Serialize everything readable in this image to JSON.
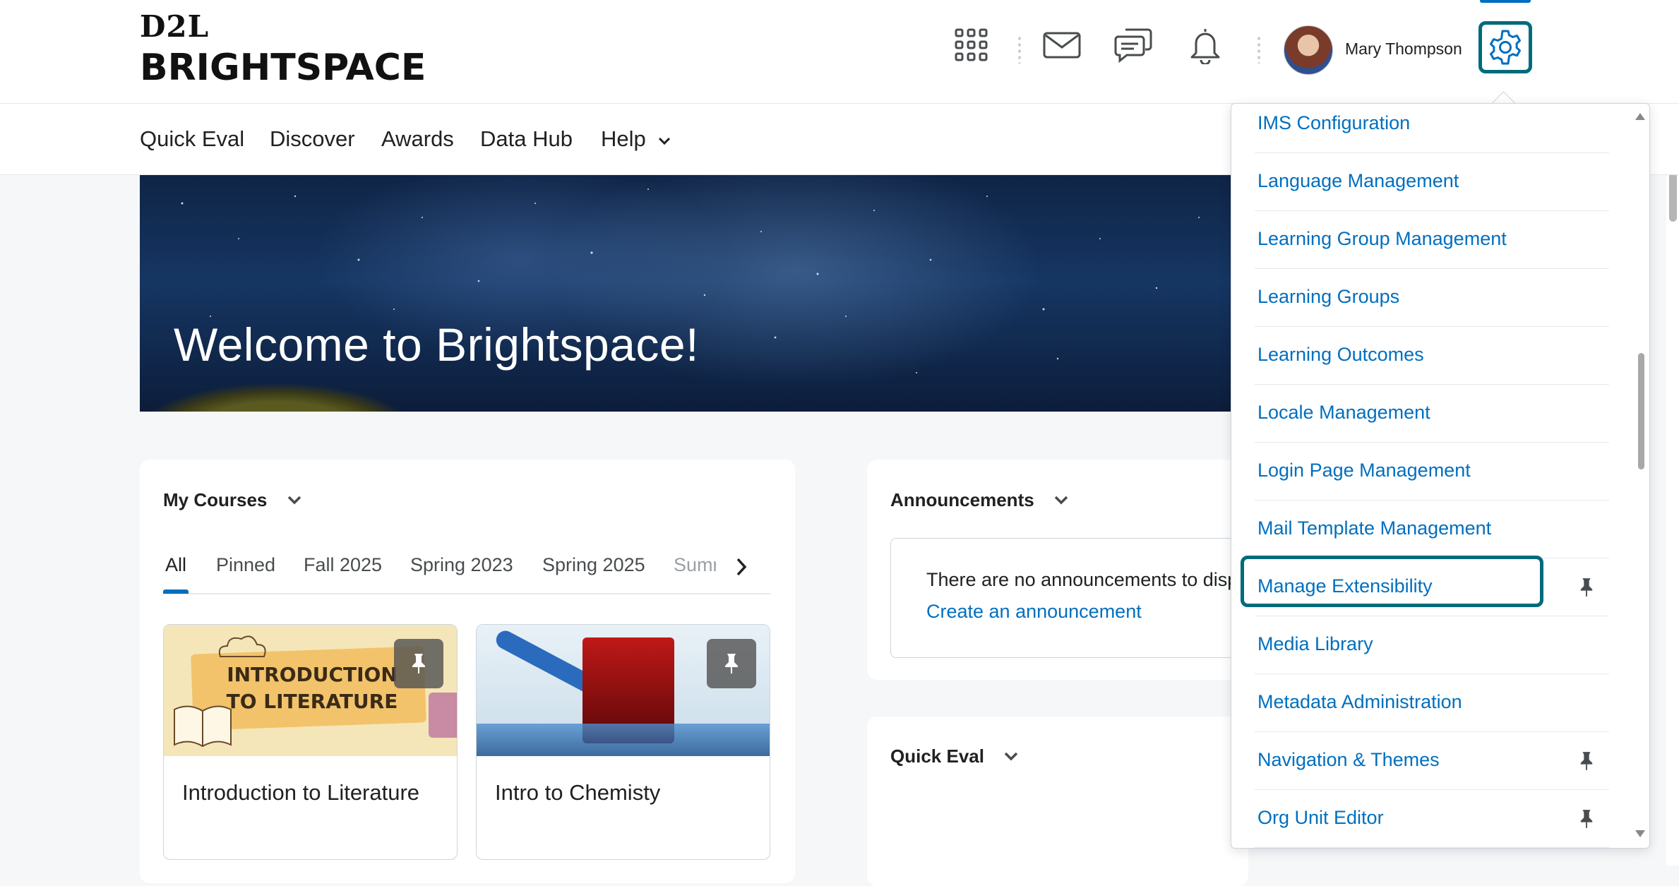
{
  "header": {
    "logo_top": "D2L",
    "logo_bottom": "BRIGHTSPACE",
    "user_name": "Mary Thompson"
  },
  "nav": {
    "items": [
      "Quick Eval",
      "Discover",
      "Awards",
      "Data Hub",
      "Help"
    ]
  },
  "banner": {
    "title": "Welcome to Brightspace!"
  },
  "my_courses": {
    "title": "My Courses",
    "tabs": [
      "All",
      "Pinned",
      "Fall 2025",
      "Spring 2023",
      "Spring 2025",
      "Sumr"
    ],
    "active_tab": "All",
    "courses": [
      {
        "name": "Introduction to Literature",
        "image_text": "INTRODUCTION TO LITERATURE"
      },
      {
        "name": "Intro to Chemisty"
      }
    ]
  },
  "announcements": {
    "title": "Announcements",
    "empty_text": "There are no announcements to disp",
    "create_link": "Create an announcement"
  },
  "quick_eval": {
    "title": "Quick Eval"
  },
  "admin_menu": {
    "items": [
      {
        "label": "IMS Configuration",
        "pinned": false
      },
      {
        "label": "Language Management",
        "pinned": false
      },
      {
        "label": "Learning Group Management",
        "pinned": false
      },
      {
        "label": "Learning Groups",
        "pinned": false
      },
      {
        "label": "Learning Outcomes",
        "pinned": false
      },
      {
        "label": "Locale Management",
        "pinned": false
      },
      {
        "label": "Login Page Management",
        "pinned": false
      },
      {
        "label": "Mail Template Management",
        "pinned": false
      },
      {
        "label": "Manage Extensibility",
        "pinned": true
      },
      {
        "label": "Media Library",
        "pinned": false
      },
      {
        "label": "Metadata Administration",
        "pinned": false
      },
      {
        "label": "Navigation & Themes",
        "pinned": true
      },
      {
        "label": "Org Unit Editor",
        "pinned": true
      }
    ]
  },
  "colors": {
    "link": "#006fbf",
    "focus_ring": "#006b7c",
    "page_bg": "#f6f7f9"
  }
}
